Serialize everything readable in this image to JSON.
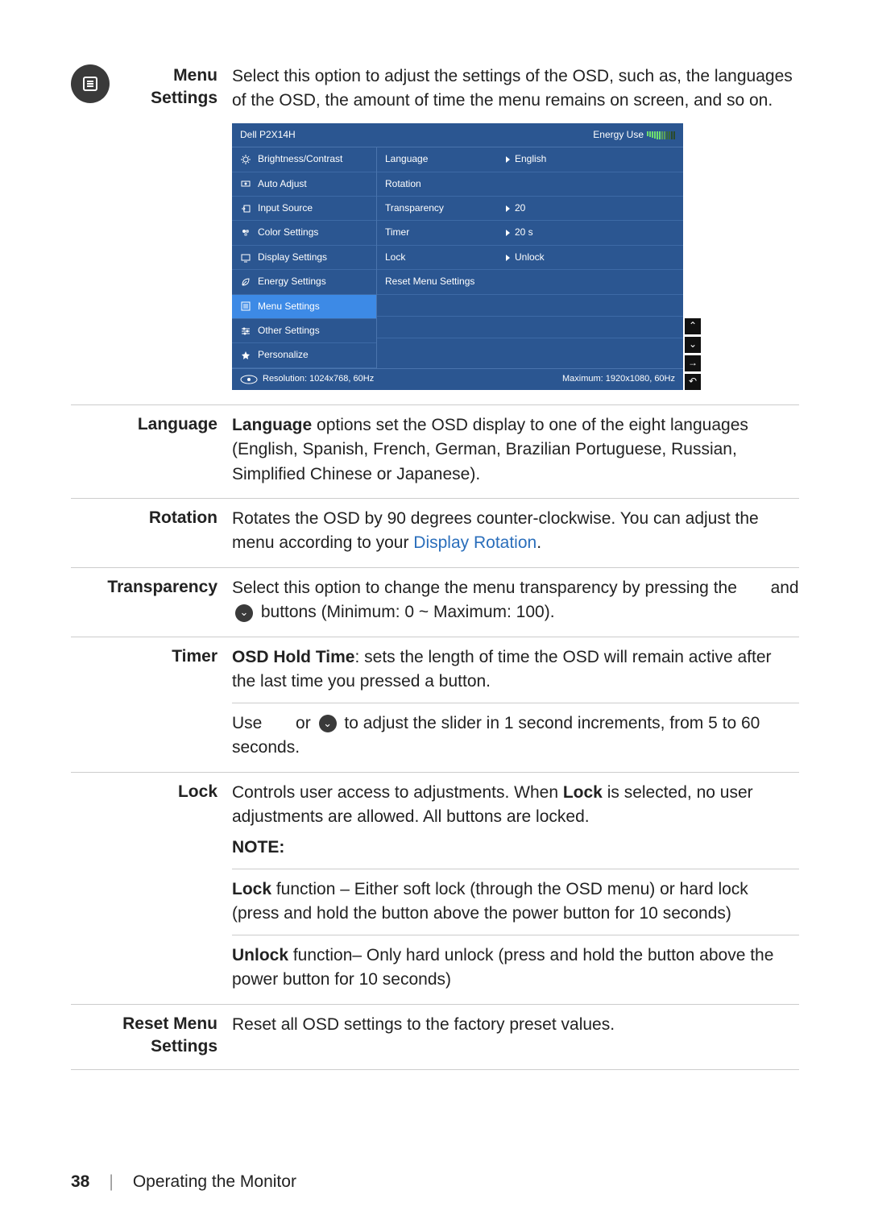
{
  "page": {
    "number": "38",
    "section": "Operating the Monitor"
  },
  "sections": {
    "menu_settings": {
      "label_line1": "Menu",
      "label_line2": "Settings",
      "body": "Select this option to adjust the settings of the OSD, such as, the languages of the OSD, the amount of time the menu remains on screen, and so on."
    },
    "language": {
      "label": "Language",
      "body_prefix_bold": "Language",
      "body_rest": " options set the OSD display to one of the eight languages (English, Spanish, French, German, Brazilian Portuguese, Russian, Simplified Chinese or Japanese)."
    },
    "rotation": {
      "label": "Rotation",
      "body_pre": "Rotates the OSD by 90 degrees counter-clockwise. You can adjust the menu according to your ",
      "link": "Display Rotation",
      "body_post": "."
    },
    "transparency": {
      "label": "Transparency",
      "body_pre": "Select this option to change the menu transparency by pressing the",
      "mid": " and ",
      "body_post": " buttons (Minimum: 0 ~ Maximum: 100)."
    },
    "timer": {
      "label": "Timer",
      "p1_bold": "OSD Hold Time",
      "p1_rest": ": sets the length of time the OSD will remain active after the last time you pressed a button.",
      "p2_pre": "Use ",
      "p2_or": " or ",
      "p2_post": " to adjust the slider in 1 second increments, from 5 to 60 seconds."
    },
    "lock": {
      "label": "Lock",
      "p1_pre": "Controls user access to adjustments. When ",
      "p1_bold": "Lock",
      "p1_post": " is selected, no user adjustments are allowed. All buttons are locked.",
      "note_label": "NOTE:",
      "p2_bold": "Lock",
      "p2_rest": " function – Either soft lock (through the OSD menu) or hard lock (press and hold the button above the power button for 10 seconds)",
      "p3_bold": "Unlock",
      "p3_rest": " function– Only hard unlock (press and hold the button above the power button for 10 seconds)"
    },
    "reset": {
      "label_line1": "Reset Menu",
      "label_line2": "Settings",
      "body": "Reset all OSD settings to the factory preset values."
    }
  },
  "osd": {
    "model": "Dell P2X14H",
    "energy_label": "Energy Use",
    "left_items": [
      {
        "label": "Brightness/Contrast",
        "icon": "sun"
      },
      {
        "label": "Auto Adjust",
        "icon": "adjust"
      },
      {
        "label": "Input Source",
        "icon": "input"
      },
      {
        "label": "Color Settings",
        "icon": "palette"
      },
      {
        "label": "Display Settings",
        "icon": "display"
      },
      {
        "label": "Energy Settings",
        "icon": "leaf"
      },
      {
        "label": "Menu Settings",
        "icon": "menu",
        "selected": true
      },
      {
        "label": "Other Settings",
        "icon": "sliders"
      },
      {
        "label": "Personalize",
        "icon": "star"
      }
    ],
    "right_rows": [
      {
        "label": "Language",
        "value": "English"
      },
      {
        "label": "Rotation",
        "value": ""
      },
      {
        "label": "Transparency",
        "value": "20"
      },
      {
        "label": "Timer",
        "value": "20 s"
      },
      {
        "label": "Lock",
        "value": "Unlock"
      },
      {
        "label": "Reset Menu Settings",
        "value": ""
      },
      {
        "label": "",
        "value": ""
      },
      {
        "label": "",
        "value": ""
      }
    ],
    "footer_resolution": "Resolution: 1024x768, 60Hz",
    "footer_maximum": "Maximum: 1920x1080, 60Hz"
  },
  "icons": {
    "up": "⌃",
    "down": "⌄",
    "right": "→",
    "back": "↶"
  }
}
